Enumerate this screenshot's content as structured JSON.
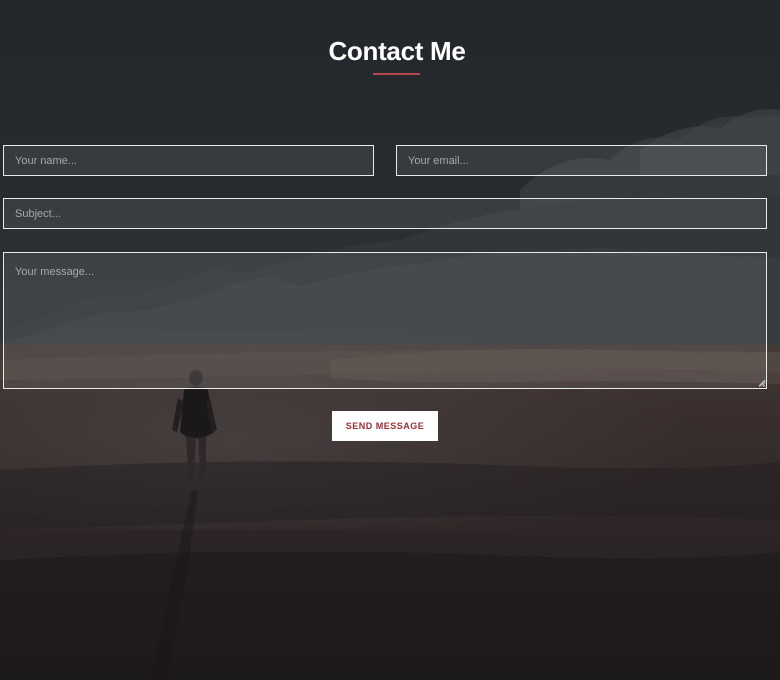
{
  "contact": {
    "title": "Contact Me",
    "accent_color": "#b5474c",
    "name_placeholder": "Your name...",
    "email_placeholder": "Your email...",
    "subject_placeholder": "Subject...",
    "message_placeholder": "Your message...",
    "send_label": "SEND MESSAGE"
  },
  "background": {
    "image": "mountain-desert-walker-photo"
  }
}
